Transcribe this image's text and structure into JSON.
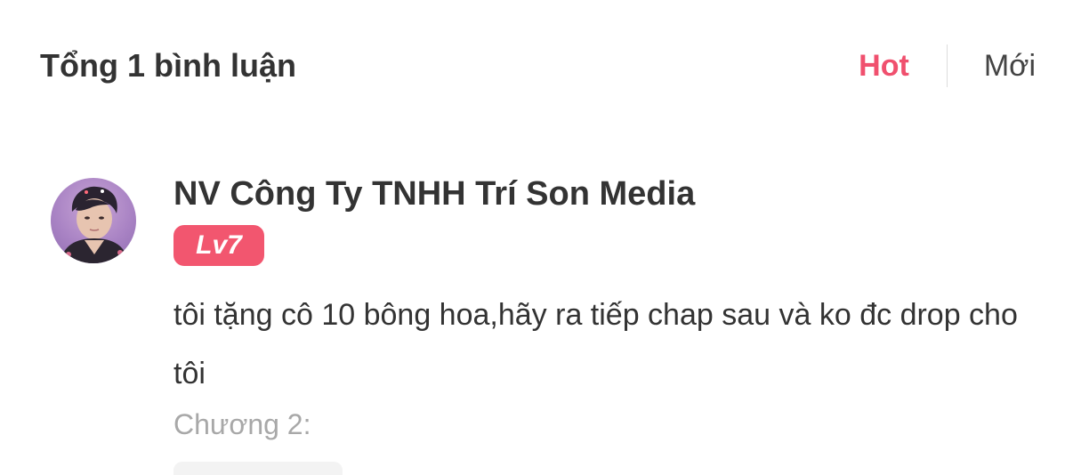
{
  "header": {
    "total_label": "Tổng 1 bình luận",
    "sort_tabs": [
      {
        "label": "Hot",
        "active": true
      },
      {
        "label": "Mới",
        "active": false
      }
    ]
  },
  "comment": {
    "username": "NV Công Ty TNHH Trí Son Media",
    "level": "Lv7",
    "text": "tôi tặng cô 10 bông hoa,hãy ra tiếp chap sau và ko đc drop cho tôi",
    "chapter": "Chương 2:"
  },
  "colors": {
    "accent": "#f0506e",
    "badge": "#f2566f",
    "muted": "#a8a8a8"
  }
}
